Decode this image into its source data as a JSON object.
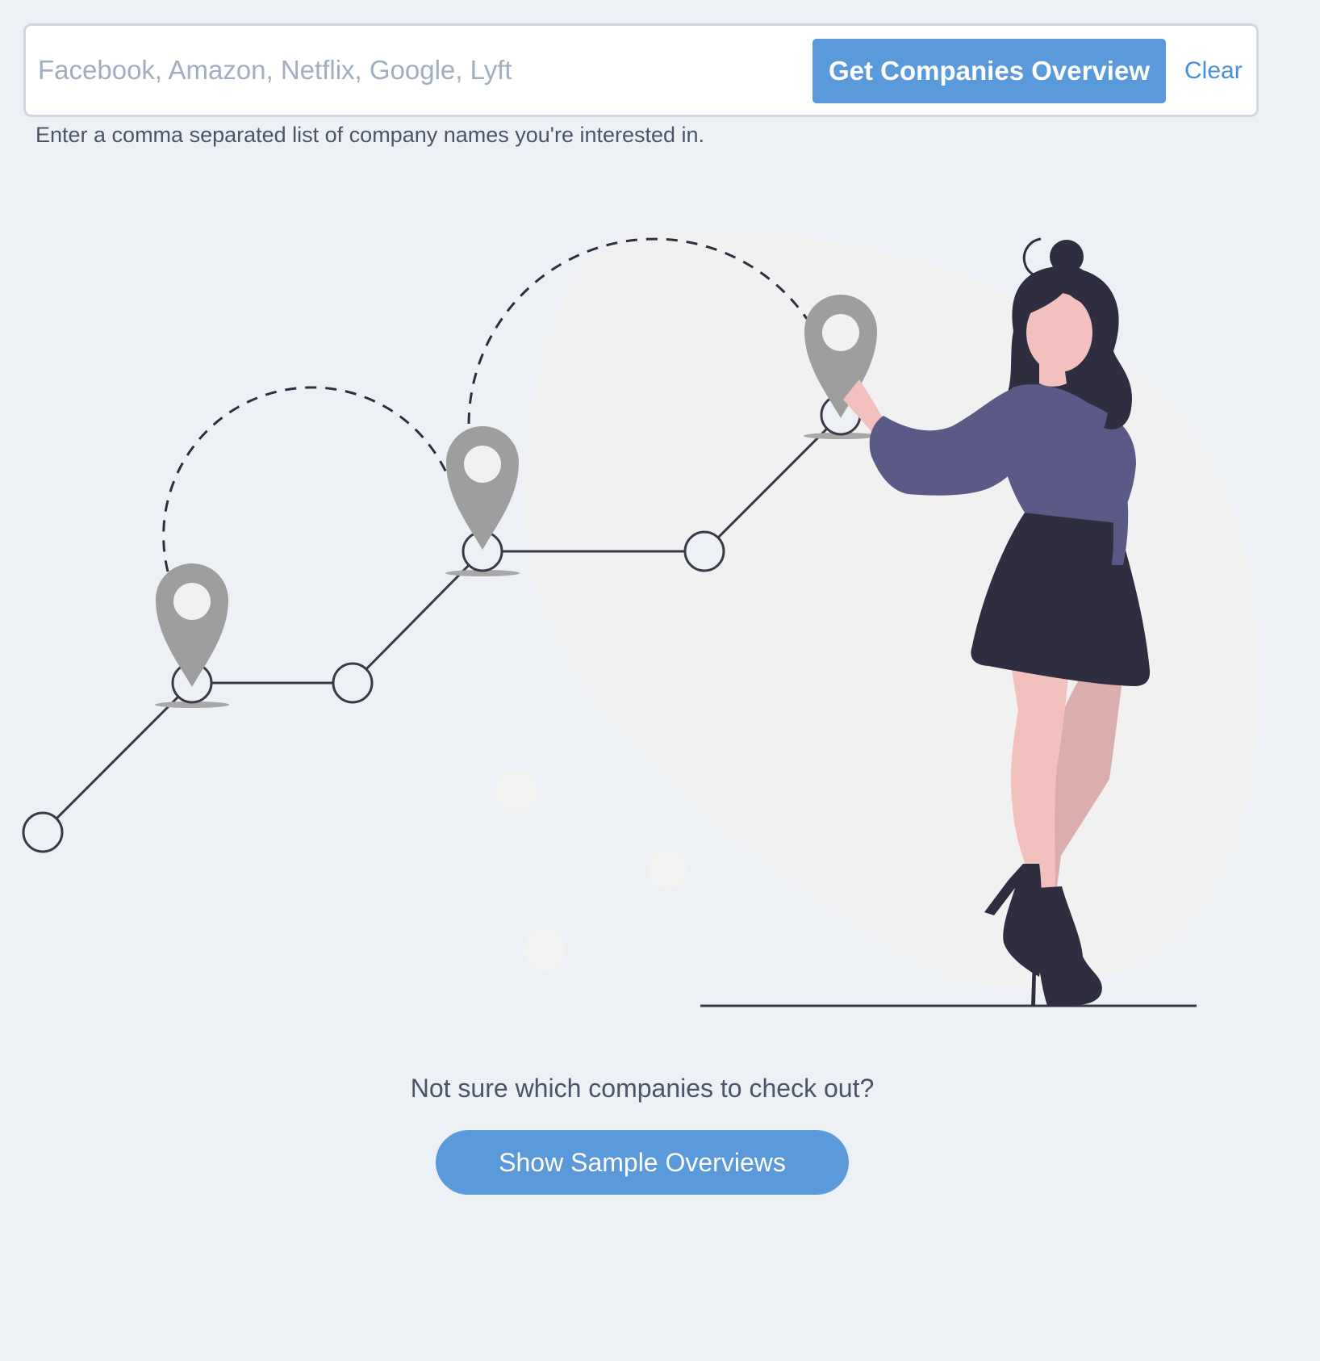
{
  "search": {
    "placeholder": "Facebook, Amazon, Netflix, Google, Lyft",
    "value": "",
    "submit_label": "Get Companies Overview",
    "clear_label": "Clear",
    "hint": "Enter a comma separated list of company names you're interested in."
  },
  "samples": {
    "prompt": "Not sure which companies to check out?",
    "button_label": "Show Sample Overviews"
  },
  "colors": {
    "page_background": "#edf1f6",
    "accent": "#5a9ada",
    "link": "#4a90d9",
    "pin": "#9e9e9e",
    "figure_dark": "#2f2e41",
    "shirt": "#5b5a87",
    "skin": "#f2c0bd"
  }
}
